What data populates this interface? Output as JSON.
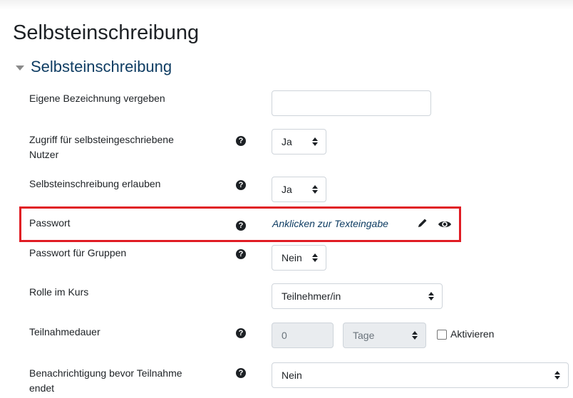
{
  "page_title": "Selbsteinschreibung",
  "section": {
    "title": "Selbsteinschreibung"
  },
  "fields": {
    "custom_name": {
      "label": "Eigene Bezeichnung vergeben",
      "value": ""
    },
    "access": {
      "label": "Zugriff für selbsteingeschriebene Nutzer",
      "value": "Ja"
    },
    "allow_enrol": {
      "label": "Selbsteinschreibung erlauben",
      "value": "Ja"
    },
    "password": {
      "label": "Passwort",
      "link_text": "Anklicken zur Texteingabe"
    },
    "group_password": {
      "label": "Passwort für Gruppen",
      "value": "Nein"
    },
    "role": {
      "label": "Rolle im Kurs",
      "value": "Teilnehmer/in"
    },
    "duration": {
      "label": "Teilnahmedauer",
      "number": "0",
      "unit": "Tage",
      "enable_label": "Aktivieren"
    },
    "notify": {
      "label": "Benachrichtigung bevor Teilnahme endet",
      "value": "Nein"
    }
  },
  "help_glyph": "?",
  "highlight_color": "#e01c24",
  "link_color": "#0f3d63",
  "icons": [
    "caret-down-icon",
    "help-icon",
    "pencil-icon",
    "eye-icon",
    "select-arrows-icon"
  ]
}
